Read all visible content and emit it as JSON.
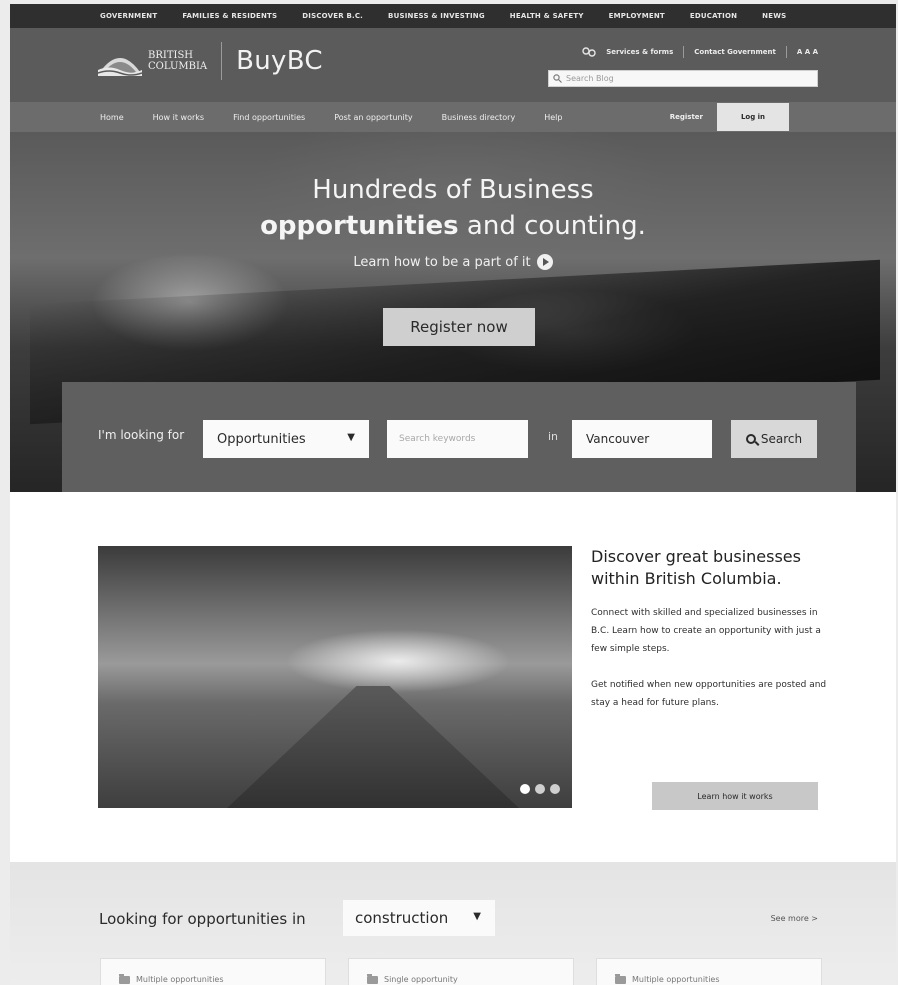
{
  "gov_nav": [
    "GOVERNMENT",
    "FAMILIES & RESIDENTS",
    "DISCOVER B.C.",
    "BUSINESS & INVESTING",
    "HEALTH & SAFETY",
    "EMPLOYMENT",
    "EDUCATION",
    "NEWS"
  ],
  "header": {
    "logo_line1": "BRITISH",
    "logo_line2": "COLUMBIA",
    "site_title": "BuyBC",
    "services_link": "Services & forms",
    "contact_link": "Contact Government",
    "text_size": "A A A",
    "search_placeholder": "Search Blog"
  },
  "nav": {
    "items": [
      "Home",
      "How it works",
      "Find opportunities",
      "Post an opportunity",
      "Business directory",
      "Help"
    ],
    "register": "Register",
    "login": "Log in"
  },
  "hero": {
    "title_line1": "Hundreds of Business",
    "title_strong": "opportunities",
    "title_rest": " and counting.",
    "subtitle": "Learn how to be a part of it",
    "register_button": "Register now"
  },
  "search_panel": {
    "label": "I'm looking for",
    "type_value": "Opportunities",
    "keywords_placeholder": "Search keywords",
    "in_label": "in",
    "location_value": "Vancouver",
    "search_button": "Search"
  },
  "feature": {
    "heading": "Discover great businesses within British Columbia.",
    "paragraph1": "Connect with skilled and specialized businesses in B.C. Learn how to create an opportunity with just a few simple steps.",
    "paragraph2": "Get notified when new opportunities are posted and stay a head for future plans.",
    "learn_button": "Learn how it works",
    "carousel_active": 1,
    "carousel_count": 3
  },
  "opportunities": {
    "title": "Looking for opportunities in",
    "category_value": "construction",
    "see_more": "See more >",
    "cards": [
      "Multiple opportunities",
      "Single opportunity",
      "Multiple opportunities"
    ]
  },
  "colors": {
    "header_bg": "#5b5b5b",
    "nav_bg": "#6c6c6c",
    "gov_bar_bg": "#2f2f2f"
  }
}
